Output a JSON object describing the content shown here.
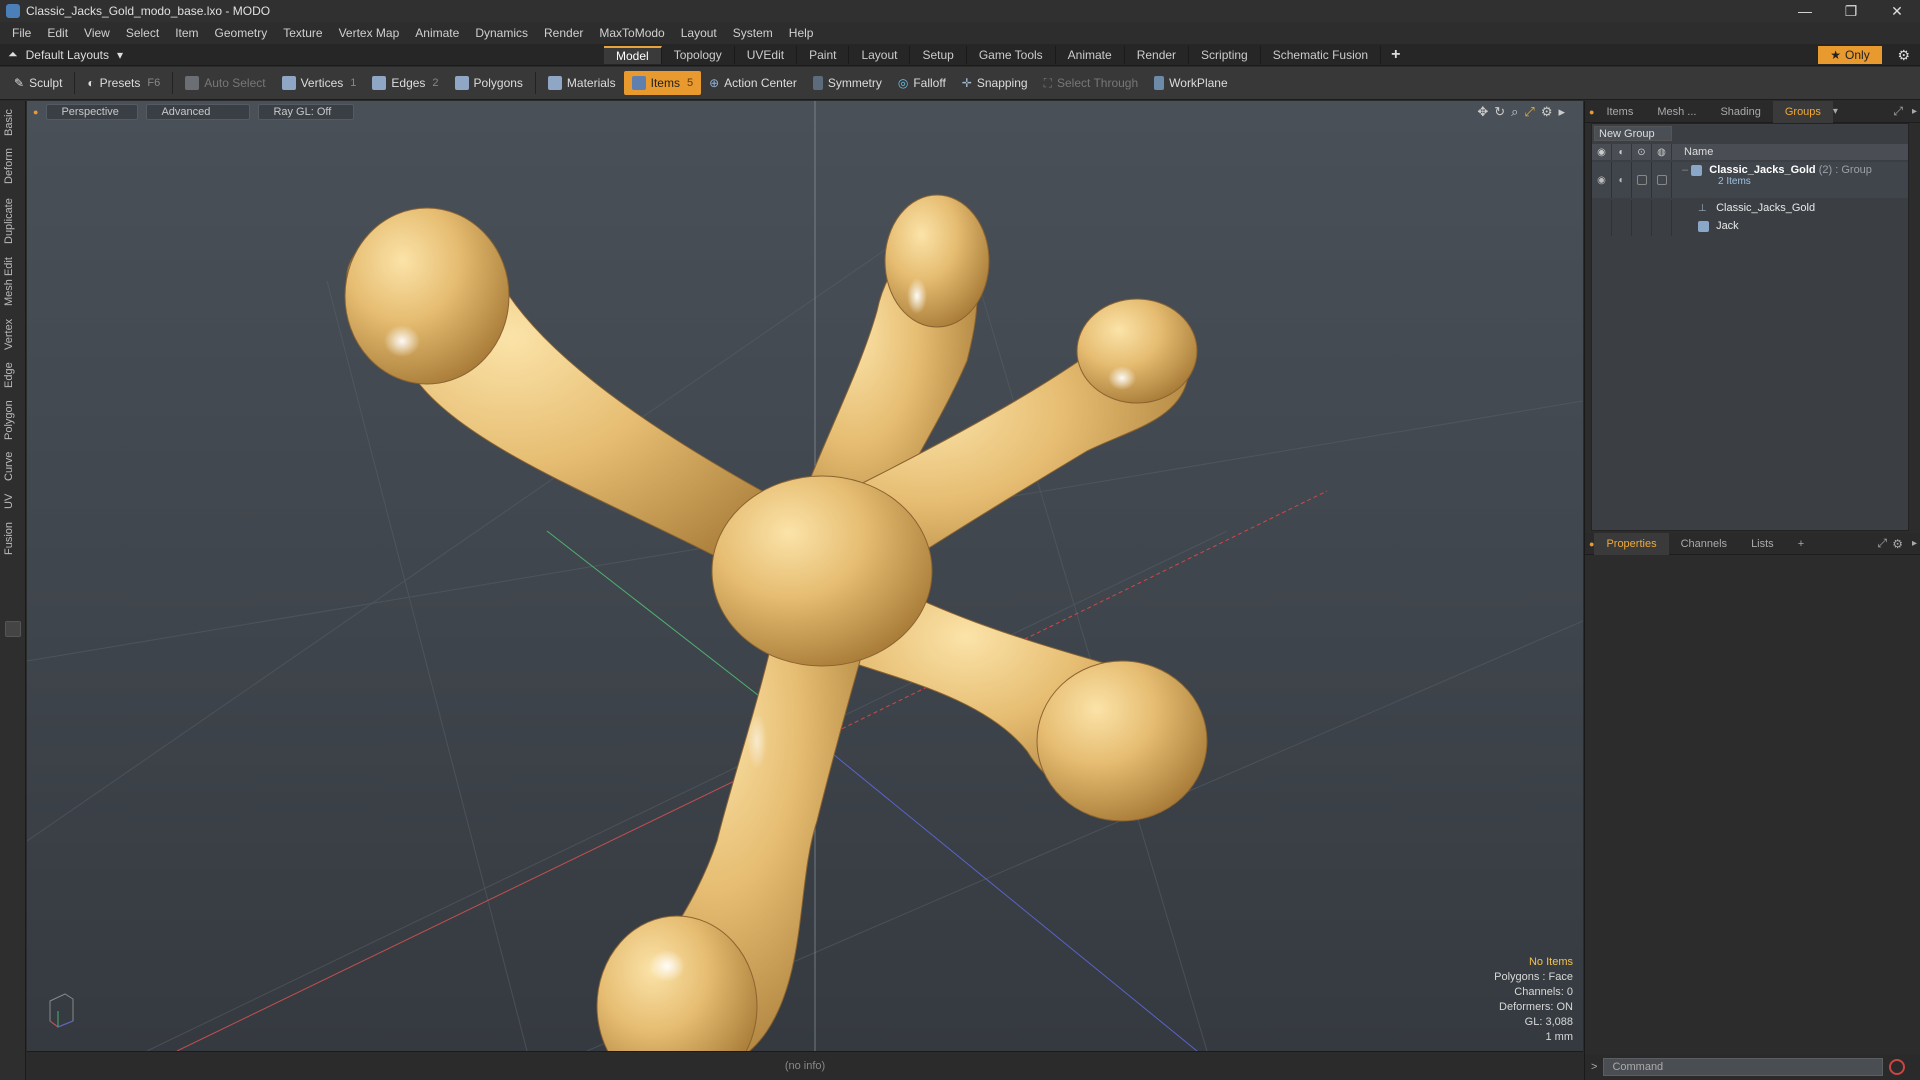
{
  "window": {
    "title": "Classic_Jacks_Gold_modo_base.lxo - MODO",
    "buttons": [
      "—",
      "❐",
      "✕"
    ]
  },
  "menu": [
    "File",
    "Edit",
    "View",
    "Select",
    "Item",
    "Geometry",
    "Texture",
    "Vertex Map",
    "Animate",
    "Dynamics",
    "Render",
    "MaxToModo",
    "Layout",
    "System",
    "Help"
  ],
  "layout_selector": "Default Layouts",
  "tabs": [
    {
      "label": "Model",
      "active": true
    },
    {
      "label": "Topology"
    },
    {
      "label": "UVEdit"
    },
    {
      "label": "Paint"
    },
    {
      "label": "Layout"
    },
    {
      "label": "Setup"
    },
    {
      "label": "Game Tools"
    },
    {
      "label": "Animate"
    },
    {
      "label": "Render"
    },
    {
      "label": "Scripting"
    },
    {
      "label": "Schematic Fusion"
    }
  ],
  "only_button": "Only",
  "toolbar": {
    "sculpt": "Sculpt",
    "presets": "Presets",
    "presets_key": "F6",
    "auto_select": "Auto Select",
    "vertices": "Vertices",
    "vertices_key": "1",
    "edges": "Edges",
    "edges_key": "2",
    "polygons": "Polygons",
    "materials": "Materials",
    "items": "Items",
    "items_key": "5",
    "action_center": "Action Center",
    "symmetry": "Symmetry",
    "falloff": "Falloff",
    "snapping": "Snapping",
    "select_through": "Select Through",
    "workplane": "WorkPlane"
  },
  "left_tabs": [
    "Basic",
    "Deform",
    "Duplicate",
    "Mesh Edit",
    "Vertex",
    "Edge",
    "Polygon",
    "Curve",
    "UV",
    "Fusion"
  ],
  "viewport": {
    "perspective": "Perspective",
    "advanced": "Advanced",
    "raygl": "Ray GL: Off",
    "info": {
      "no_items": "No Items",
      "polygons": "Polygons : Face",
      "channels": "Channels: 0",
      "deformers": "Deformers: ON",
      "gl": "GL: 3,088",
      "unit": "1 mm"
    }
  },
  "status": "(no info)",
  "groups_panel": {
    "tabs": [
      {
        "label": "Items"
      },
      {
        "label": "Mesh ..."
      },
      {
        "label": "Shading"
      },
      {
        "label": "Groups",
        "active": true
      }
    ],
    "new_group": "New Group",
    "name_header": "Name",
    "group": {
      "name": "Classic_Jacks_Gold",
      "count": "(2)",
      "type": ": Group",
      "sub": "2 Items",
      "children": [
        "Classic_Jacks_Gold",
        "Jack"
      ]
    }
  },
  "props_panel": {
    "tabs": [
      {
        "label": "Properties",
        "active": true
      },
      {
        "label": "Channels"
      },
      {
        "label": "Lists"
      },
      {
        "label": "+"
      }
    ]
  },
  "command": {
    "placeholder": "Command"
  },
  "colors": {
    "accent": "#e89a2e",
    "gold": "#e8c078",
    "bg": "#2b2b2b"
  }
}
